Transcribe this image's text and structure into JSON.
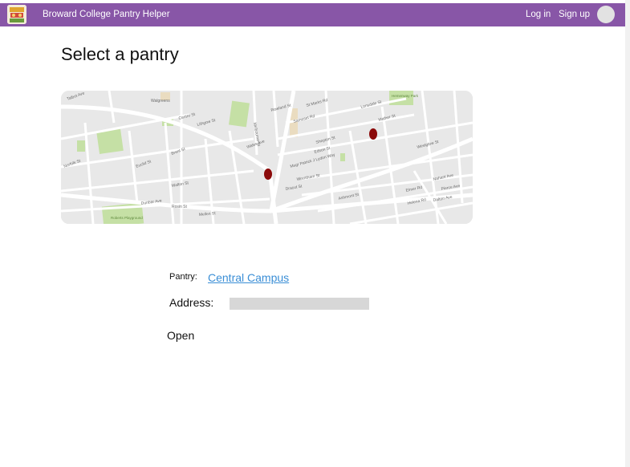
{
  "app": {
    "title": "Broward College Pantry Helper"
  },
  "nav": {
    "login_label": "Log in",
    "signup_label": "Sign up"
  },
  "page": {
    "title": "Select a pantry"
  },
  "map": {
    "labels": {
      "park_top": "Hemenway Park",
      "park_bottom": "Roberts Playground",
      "pharmacy": "Walgreens",
      "s1": "Talbot Ave",
      "s2": "Centre St",
      "s3": "Lithgow St",
      "s4": "Wales Ave",
      "s5": "Brent St",
      "s6": "Euclid St",
      "s7": "Walton St",
      "s8": "Dunbar Ave",
      "s9": "Mellen St",
      "s10": "Rosin St",
      "s11": "Melbourne St",
      "s12": "Rowland St",
      "s13": "Samoset Rd",
      "s14": "St Marks Rd",
      "s15": "Lonsdale St",
      "s16": "Shepton St",
      "s17": "Edson St",
      "s18": "Msgr Patrick J Lydon Way",
      "s19": "Wrentham St",
      "s20": "Ashmont St",
      "s21": "Westglow St",
      "s22": "Elmer Rd",
      "s23": "Helena Rd",
      "s24": "Dalton Ave",
      "s25": "Pierce Ave",
      "s26": "Nahant Ave",
      "s27": "Mather St",
      "s28": "Dracut St",
      "s29": "Norfolk St"
    },
    "colors": {
      "marker": "#8b0a0a",
      "park": "#c5e0a5",
      "road": "#ffffff",
      "base": "#e5e5e5"
    }
  },
  "details": {
    "pantry_label": "Pantry:",
    "pantry_name": "Central Campus",
    "address_label": "Address:",
    "address_value": "",
    "status": "Open"
  },
  "colors": {
    "topbar": "#8856a7",
    "link": "#3a8ed6",
    "address_placeholder": "#d7d7d7"
  }
}
